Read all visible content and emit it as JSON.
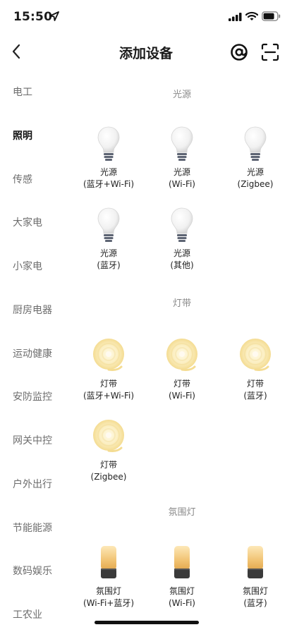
{
  "status_bar": {
    "time": "15:50"
  },
  "header": {
    "title": "添加设备"
  },
  "sidebar": {
    "items": [
      {
        "label": "电工",
        "active": false
      },
      {
        "label": "照明",
        "active": true
      },
      {
        "label": "传感",
        "active": false
      },
      {
        "label": "大家电",
        "active": false
      },
      {
        "label": "小家电",
        "active": false
      },
      {
        "label": "厨房电器",
        "active": false
      },
      {
        "label": "运动健康",
        "active": false
      },
      {
        "label": "安防监控",
        "active": false
      },
      {
        "label": "网关中控",
        "active": false
      },
      {
        "label": "户外出行",
        "active": false
      },
      {
        "label": "节能能源",
        "active": false
      },
      {
        "label": "数码娱乐",
        "active": false
      },
      {
        "label": "工农业",
        "active": false
      }
    ]
  },
  "sections": [
    {
      "title": "光源",
      "devices": [
        {
          "name": "光源",
          "sub": "(蓝牙+Wi-Fi)",
          "icon": "bulb-icon"
        },
        {
          "name": "光源",
          "sub": "(Wi-Fi)",
          "icon": "bulb-icon"
        },
        {
          "name": "光源",
          "sub": "(Zigbee)",
          "icon": "bulb-icon"
        },
        {
          "name": "光源",
          "sub": "(蓝牙)",
          "icon": "bulb-icon"
        },
        {
          "name": "光源",
          "sub": "(其他)",
          "icon": "bulb-icon"
        }
      ]
    },
    {
      "title": "灯带",
      "devices": [
        {
          "name": "灯带",
          "sub": "(蓝牙+Wi-Fi)",
          "icon": "light-strip-icon"
        },
        {
          "name": "灯带",
          "sub": "(Wi-Fi)",
          "icon": "light-strip-icon"
        },
        {
          "name": "灯带",
          "sub": "(蓝牙)",
          "icon": "light-strip-icon"
        },
        {
          "name": "灯带",
          "sub": "(Zigbee)",
          "icon": "light-strip-icon"
        }
      ]
    },
    {
      "title": "氛围灯",
      "devices": [
        {
          "name": "氛围灯",
          "sub": "(Wi-Fi+蓝牙)",
          "icon": "ambient-lamp-icon"
        },
        {
          "name": "氛围灯",
          "sub": "(Wi-Fi)",
          "icon": "ambient-lamp-icon"
        },
        {
          "name": "氛围灯",
          "sub": "(蓝牙)",
          "icon": "ambient-lamp-icon"
        }
      ]
    }
  ]
}
